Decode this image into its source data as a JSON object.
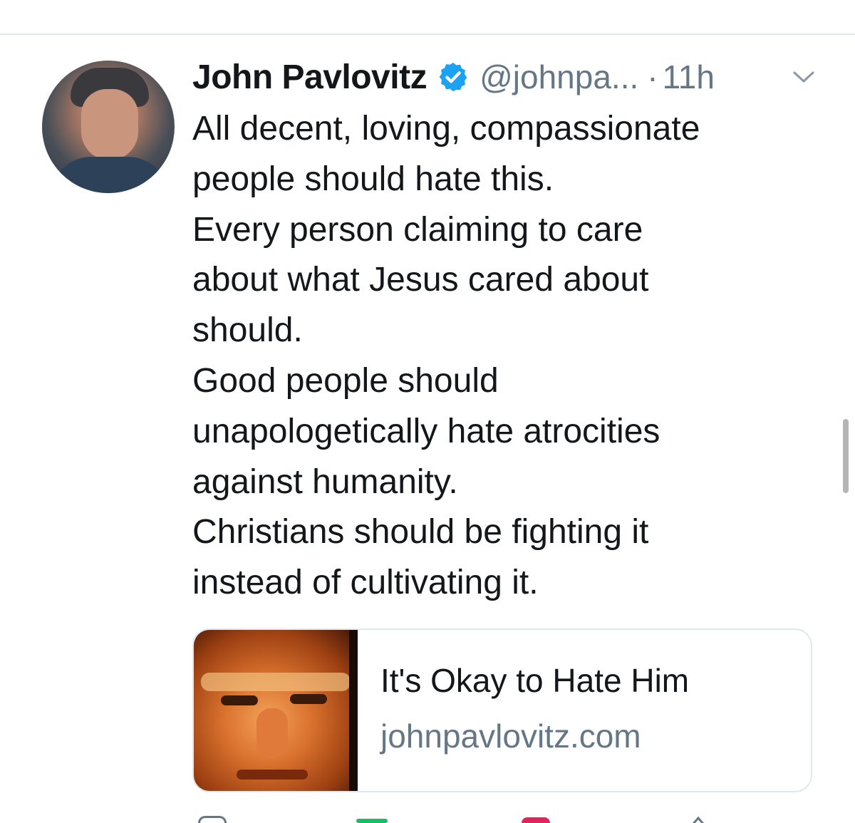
{
  "tweet": {
    "author_name": "John Pavlovitz",
    "handle": "@johnpa...",
    "separator": "·",
    "time": "11h",
    "text_lines": [
      "All decent, loving, compassionate",
      "people should hate this.",
      "Every person claiming to care",
      "about what Jesus cared about",
      "should.",
      "Good people should",
      "unapologetically hate atrocities",
      "against humanity.",
      "Christians should be fighting it",
      "instead of cultivating it."
    ]
  },
  "link_card": {
    "title": "It's Okay to Hate Him",
    "domain": "johnpavlovitz.com"
  },
  "icons": {
    "verified": "verified-badge-icon",
    "menu": "chevron-down-icon"
  },
  "colors": {
    "text": "#14171a",
    "secondary": "#657786",
    "verified": "#1da1f2",
    "border": "#e1e8ed",
    "retweet": "#17bf63",
    "like": "#e0245e"
  }
}
